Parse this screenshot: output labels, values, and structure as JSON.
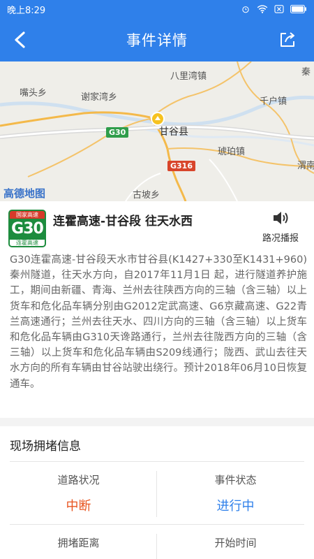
{
  "status_bar": {
    "time": "晚上8:29"
  },
  "nav": {
    "title": "事件详情"
  },
  "map": {
    "labels": {
      "balixian": "八里湾镇",
      "qin": "秦",
      "xiantoux": "嘴头乡",
      "xiejiawan": "谢家湾乡",
      "qianhu": "千户镇",
      "gangu": "甘谷县",
      "hupo": "琥珀镇",
      "wei": "渭南",
      "gupo": "古坡乡"
    },
    "roads": {
      "g30": "G30",
      "g316": "G316"
    },
    "logo": "高德地图"
  },
  "event": {
    "shield": {
      "top": "国家高速",
      "code": "G30",
      "bottom": "连霍高速"
    },
    "title": "连霍高速-甘谷段  往天水西",
    "voice_label": "路况播报",
    "description": "G30连霍高速-甘谷段天水市甘谷县(K1427+330至K1431+960)秦州隧道，往天水方向，自2017年11月1日 起，进行隧道养护施工，期间由新疆、青海、兰州去往陕西方向的三轴（含三轴）以上货车和危化品车辆分别由G2012定武高速、G6京藏高速、G22青兰高速通行；兰州去往天水、四川方向的三轴（含三轴）以上货车和危化品车辆由G310天谗路通行，兰州去往陇西方向的三轴（含三轴）以上货车和危化品车辆由S209线通行；陇西、武山去往天水方向的所有车辆由甘谷站驶出绕行。预计2018年06月10日恢复通车。"
  },
  "congestion": {
    "title": "现场拥堵信息",
    "road_status_label": "道路状况",
    "road_status_value": "中断",
    "event_status_label": "事件状态",
    "event_status_value": "进行中",
    "distance_label": "拥堵距离",
    "start_time_label": "开始时间"
  },
  "colors": {
    "primary": "#2f80ea",
    "interrupt": "#e8541f",
    "ongoing": "#2f80ea"
  }
}
